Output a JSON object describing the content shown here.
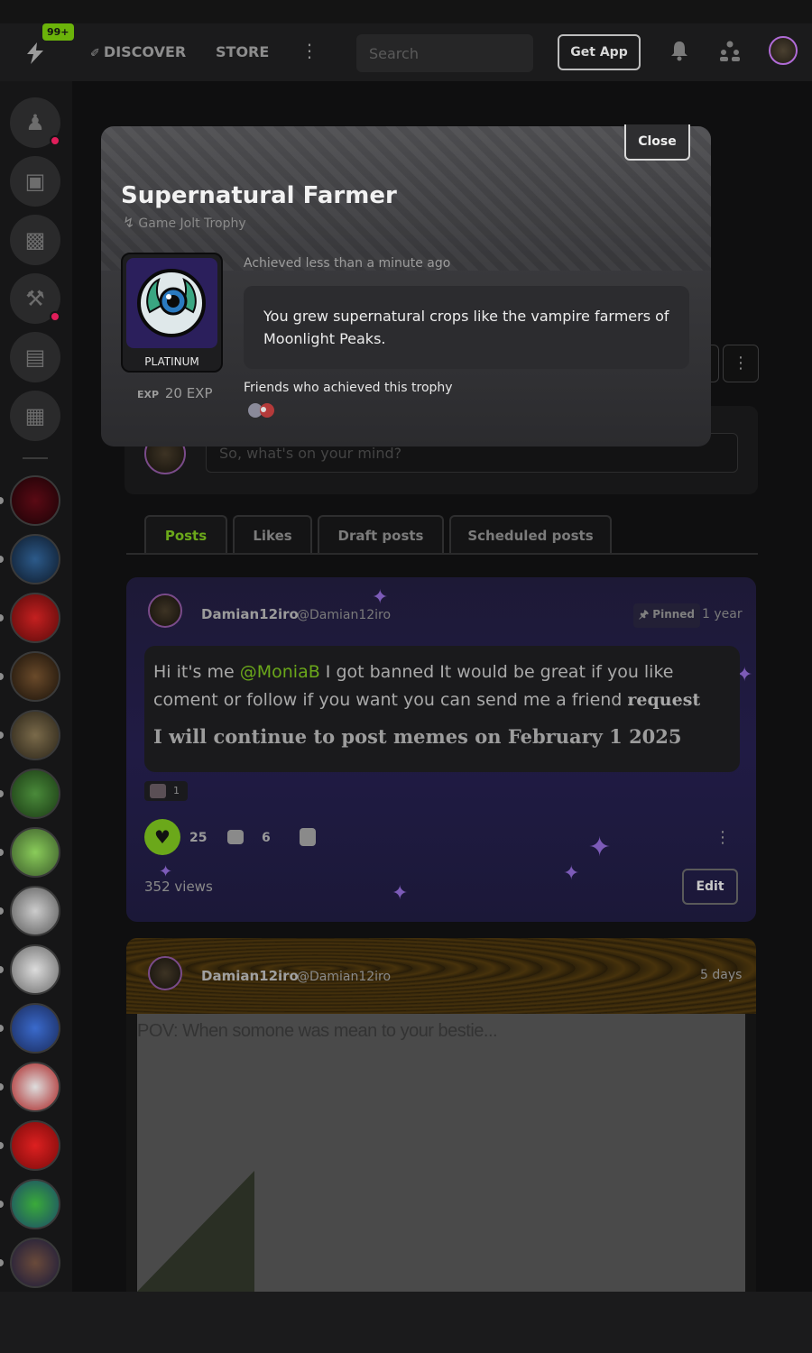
{
  "topbar": {
    "notification_badge": "99+",
    "nav_discover": "DISCOVER",
    "nav_store": "STORE",
    "search_placeholder": "Search",
    "get_app_label": "Get App"
  },
  "sidebar": {
    "icons": [
      "game-dev-icon",
      "store-icon",
      "backpack-icon",
      "forge-icon",
      "chat-icon",
      "library-icon"
    ],
    "community_count": 14
  },
  "modal": {
    "close_label": "Close",
    "title": "Supernatural Farmer",
    "subtitle": "Game Jolt Trophy",
    "tier": "PLATINUM",
    "exp": "20 EXP",
    "exp_icon_label": "EXP",
    "achieved": "Achieved less than a minute ago",
    "description": "You grew supernatural crops like the vampire farmers of Moonlight Peaks.",
    "friends_heading": "Friends who achieved this trophy"
  },
  "composer": {
    "placeholder": "So, what's on your mind?"
  },
  "tabs": [
    {
      "label": "Posts",
      "active": true
    },
    {
      "label": "Likes",
      "active": false
    },
    {
      "label": "Draft posts",
      "active": false
    },
    {
      "label": "Scheduled posts",
      "active": false
    }
  ],
  "post1": {
    "author": "Damian12iro",
    "handle": "@Damian12iro",
    "pinned_label": "Pinned",
    "time": "1 year",
    "text_before_mention": "Hi it's me ",
    "mention": "@MoniaB",
    "text_after_mention": " I got banned It would be great if you like coment or follow if you want you can send me a friend ",
    "text_bold_word": "request",
    "bold_line": "I will continue to post memes on February 1 2025",
    "reaction_count": "1",
    "likes": "25",
    "comments": "6",
    "views": "352 views",
    "edit_label": "Edit"
  },
  "post2": {
    "author": "Damian12iro",
    "handle": "@Damian12iro",
    "time": "5 days",
    "caption": "POV: When somone was mean to your bestie..."
  },
  "colors": {
    "accent": "#6ba81a",
    "notification": "#e01e5a",
    "modal_bg": "#3a3a3d"
  }
}
